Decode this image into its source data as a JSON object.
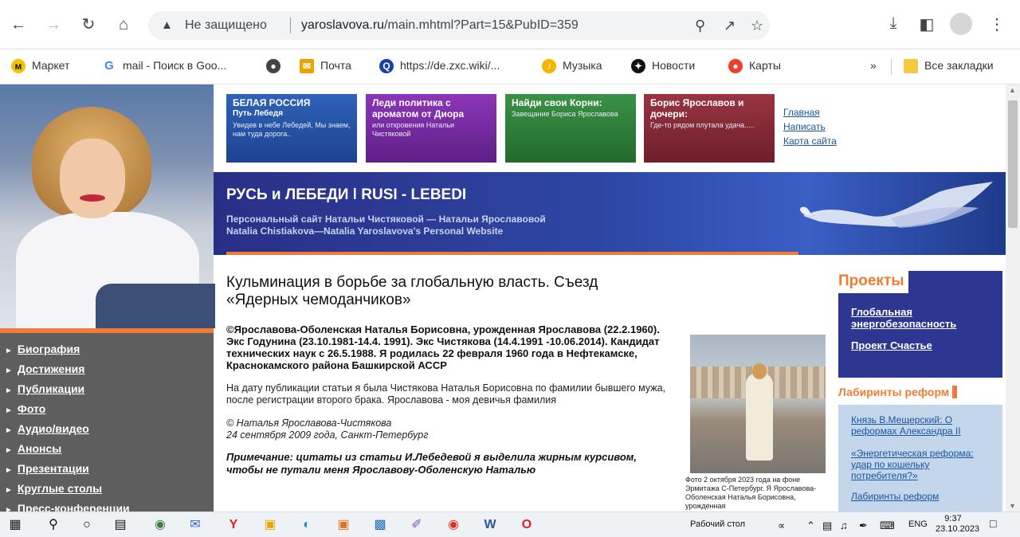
{
  "browser": {
    "security_label": "Не защищено",
    "url_domain": "yaroslavova.ru",
    "url_path": "/main.mhtml?Part=15&PubID=359"
  },
  "bookmarks": {
    "items": [
      {
        "label": "Маркет",
        "icon": "market-icon",
        "color": "#f5c200"
      },
      {
        "label": "mail - Поиск в Goo...",
        "icon": "google-icon",
        "color": "#4285f4"
      },
      {
        "label": "",
        "icon": "globe-icon",
        "color": "#444444"
      },
      {
        "label": "Почта",
        "icon": "mail-icon",
        "color": "#e8a300"
      },
      {
        "label": "https://de.zxc.wiki/...",
        "icon": "wiki-icon",
        "color": "#1a3fa3"
      },
      {
        "label": "Музыка",
        "icon": "music-icon",
        "color": "#f5b400"
      },
      {
        "label": "Новости",
        "icon": "news-icon",
        "color": "#111111"
      },
      {
        "label": "Карты",
        "icon": "maps-icon",
        "color": "#f03e2a"
      }
    ],
    "overflow": "»",
    "all_label": "Все закладки"
  },
  "promos": [
    {
      "title": "БЕЛАЯ РОССИЯ",
      "subtitle": "Путь Лебедя",
      "desc": "Увидев в небе Лебедей, Мы знаем, нам туда дорога..",
      "color": "#2453a6"
    },
    {
      "title": "Леди политика с ароматом от Диора",
      "subtitle": "",
      "desc": "или откровения Натальи Чистяковой",
      "color": "#7a2aa6"
    },
    {
      "title": "Найди свои Корни:",
      "subtitle": "",
      "desc": "Завещание Бориса Ярославова",
      "color": "#2e7e3a"
    },
    {
      "title": "Борис Ярославов и дочери:",
      "subtitle": "",
      "desc": "Где-то рядом плутала удача.....",
      "color": "#8a2a36"
    }
  ],
  "toplinks": [
    "Главная",
    "Написать",
    "Карта сайта"
  ],
  "banner": {
    "title": "РУСЬ и ЛЕБЕДИ ǀ RUSI - LEBEDI",
    "sub1": "Персональный сайт Натальи Чистяковой — Натальи Ярославовой",
    "sub2": "Natalia Chistiakova—Natalia Yaroslavova's Personal Website"
  },
  "leftnav": [
    "Биография",
    "Достижения",
    "Публикации",
    "Фото",
    "Аудио/видео",
    "Анонсы",
    "Презентации",
    "Круглые столы",
    "Пресс-конференции"
  ],
  "article": {
    "title": "Кульминация в борьбе за глобальную власть. Съезд «Ядерных чемоданчиков»",
    "bold": "©Ярославова-Оболенская Наталья Борисовна, урожденная Ярославова (22.2.1960). Экс Годунина (23.10.1981-14.4. 1991). Экс Чистякова (14.4.1991 -10.06.2014). Кандидат технических наук с 26.5.1988. Я родилась 22 февраля 1960 года в Нефтекамске, Краснокамского района Башкирской АССР",
    "para": "На дату публикации статьи я была Чистякова Наталья Борисовна по фамилии бывшего мужа, после регистрации второго брака. Ярославова - моя девичья фамилия",
    "sig1": "© Наталья Ярославова-Чистякова",
    "sig2": "24 сентября 2009 года, Санкт-Петербург",
    "note": "Примечание: цитаты из статьи И.Лебедевой я выделила жирным курсивом, чтобы не путали меня Ярославову-Оболенскую Наталью"
  },
  "photo_caption": "Фото 2 октября 2023 года на фоне Эрмитажа С-Петербург. Я Ярославова-Оболенская Наталья Борисовна, урожденная",
  "projects": {
    "heading": "Проекты",
    "links": [
      "Глобальная энергобезопасность",
      "Проект Счастье"
    ]
  },
  "labyrinths": {
    "heading": "Лабиринты реформ",
    "links": [
      "Князь В.Мещерский: О реформах Александра II",
      "«Энергетическая реформа: удар по кошельку потребителя?»",
      "Лабиринты реформ"
    ]
  },
  "taskbar": {
    "desktop_label": "Рабочий стол",
    "lang": "ENG",
    "time": "9:37",
    "date": "23.10.2023"
  }
}
